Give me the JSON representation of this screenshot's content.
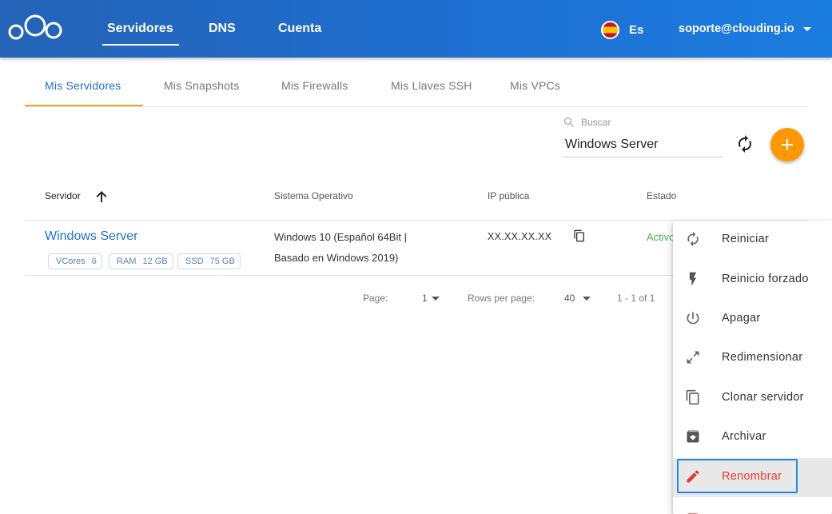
{
  "header": {
    "nav": [
      "Servidores",
      "DNS",
      "Cuenta"
    ],
    "active_nav": "Servidores",
    "language": "Es",
    "account_email": "soporte@clouding.io"
  },
  "tabs": [
    "Mis Servidores",
    "Mis Snapshots",
    "Mis Firewalls",
    "Mis Llaves SSH",
    "Mis VPCs"
  ],
  "active_tab": "Mis Servidores",
  "search": {
    "label": "Buscar",
    "value": "Windows Server"
  },
  "table": {
    "headers": {
      "server": "Servidor",
      "os": "Sistema Operativo",
      "ip": "IP pública",
      "status": "Estado"
    },
    "rows": [
      {
        "name": "Windows Server",
        "chips": [
          {
            "label": "VCores",
            "value": "6"
          },
          {
            "label": "RAM",
            "value": "12 GB"
          },
          {
            "label": "SSD",
            "value": "75 GB"
          }
        ],
        "os_line1": "Windows 10 (Español 64Bit |",
        "os_line2": "Basado en Windows 2019)",
        "ip": "XX.XX.XX.XX",
        "status": "Activo"
      }
    ]
  },
  "pagination": {
    "page_label": "Page:",
    "page_value": "1",
    "rows_label": "Rows per page:",
    "rows_value": "40",
    "range": "1 - 1 of 1"
  },
  "context_menu": {
    "items": [
      {
        "label": "Reiniciar",
        "icon": "refresh-icon"
      },
      {
        "label": "Reinicio forzado",
        "icon": "flash-icon"
      },
      {
        "label": "Apagar",
        "icon": "power-icon"
      },
      {
        "label": "Redimensionar",
        "icon": "resize-arrows-icon"
      },
      {
        "label": "Clonar servidor",
        "icon": "copy-icon"
      },
      {
        "label": "Archivar",
        "icon": "archive-icon"
      },
      {
        "label": "Renombrar",
        "icon": "pencil-icon"
      }
    ],
    "highlighted": "Renombrar"
  },
  "colors": {
    "header_blue": "#1e6fd1",
    "accent_orange": "#ff9800",
    "tab_underline": "#f5a623",
    "status_green": "#4caf50",
    "danger_red": "#e53935",
    "focus_blue": "#1e88e5"
  }
}
